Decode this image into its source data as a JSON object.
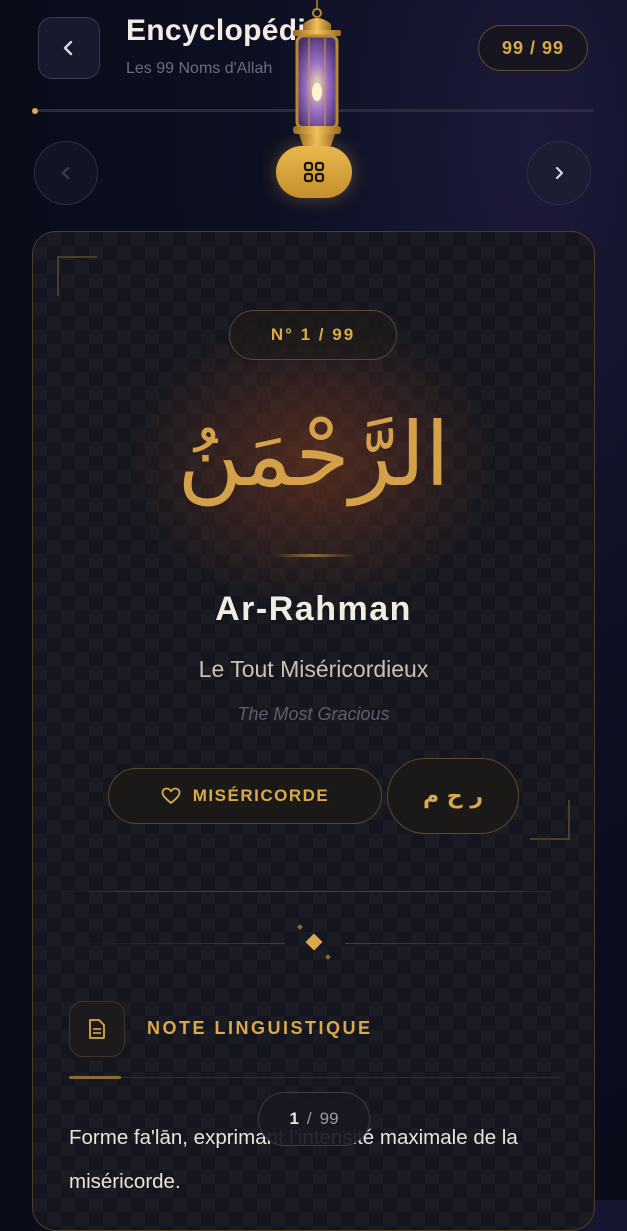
{
  "header": {
    "title": "Encyclopédie",
    "subtitle": "Les 99 Noms d'Allah",
    "counter": "99 / 99",
    "progress": 0.01
  },
  "card": {
    "number_badge": "N° 1 / 99",
    "arabic_name": "الرَّحْمَنُ",
    "transliteration": "Ar-Rahman",
    "french_meaning": "Le Tout Miséricordieux",
    "english_meaning": "The Most Gracious",
    "tag_label": "MISÉRICORDE",
    "root_letters": "ر ح م"
  },
  "note": {
    "heading": "NOTE LINGUISTIQUE",
    "body": "Forme fa'lān, exprimant l'intensité maximale de la miséricorde."
  },
  "pager": {
    "current": "1",
    "separator": "/",
    "total": "99"
  },
  "colors": {
    "accent_gold": "#d9a94a",
    "background": "#0d1022",
    "card_background": "#14151e"
  },
  "icons": [
    "chevron-left-icon",
    "chevron-right-icon",
    "lantern-icon",
    "grid-icon",
    "heart-icon",
    "document-icon"
  ]
}
